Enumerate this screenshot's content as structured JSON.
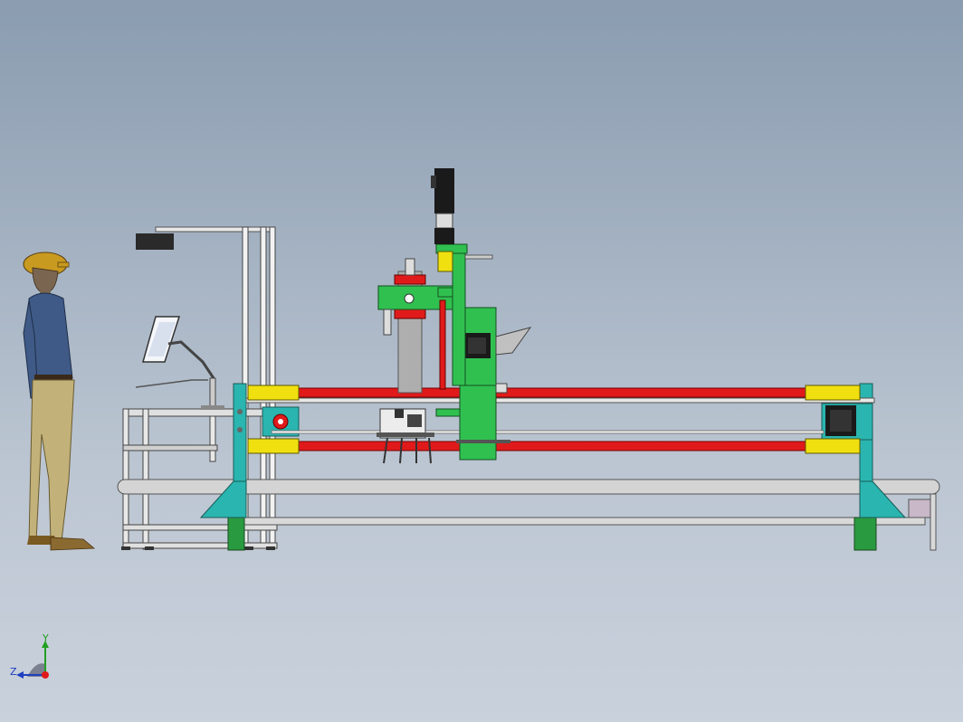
{
  "viewport": {
    "background_top": "#8a9cb0",
    "background_bottom": "#c9d1dc"
  },
  "colors": {
    "frame_teal": "#2ab5b0",
    "rail_red": "#e01a1a",
    "sleeve_yellow": "#f0e010",
    "carriage_green": "#30c050",
    "base_gray": "#d4d4d4",
    "foot_green": "#2a9a40",
    "motor_black": "#1a1a1a"
  },
  "triad": {
    "y_label": "Y",
    "z_label": "Z",
    "icon": "coordinate-triad-icon"
  }
}
